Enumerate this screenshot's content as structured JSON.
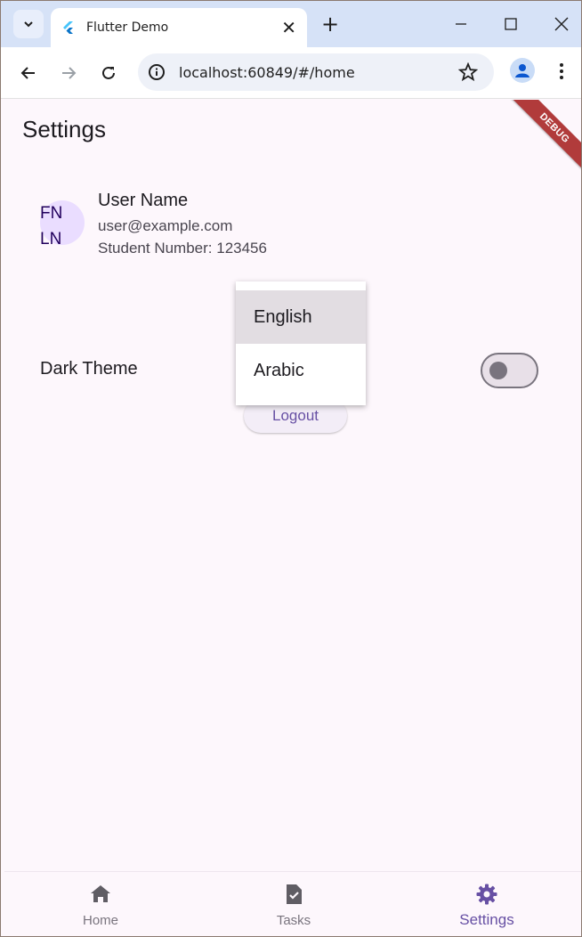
{
  "browser": {
    "tab_title": "Flutter Demo",
    "url": "localhost:60849/#/home"
  },
  "app": {
    "title": "Settings",
    "debug_banner": "DEBUG",
    "user": {
      "avatar_initials": "FN LN",
      "name": "User Name",
      "email": "user@example.com",
      "student_number": "Student Number: 123456"
    },
    "language_menu": {
      "options": [
        "English",
        "Arabic"
      ],
      "selected": "English"
    },
    "dark_theme": {
      "label": "Dark Theme",
      "enabled": false
    },
    "logout_label": "Logout",
    "bottom_nav": {
      "items": [
        {
          "label": "Home",
          "icon": "home-icon"
        },
        {
          "label": "Tasks",
          "icon": "task-icon"
        },
        {
          "label": "Settings",
          "icon": "settings-icon"
        }
      ],
      "active": "Settings"
    },
    "colors": {
      "primary": "#6750a4",
      "background": "#fdf7fc",
      "debug_banner": "#b13b3b"
    }
  }
}
